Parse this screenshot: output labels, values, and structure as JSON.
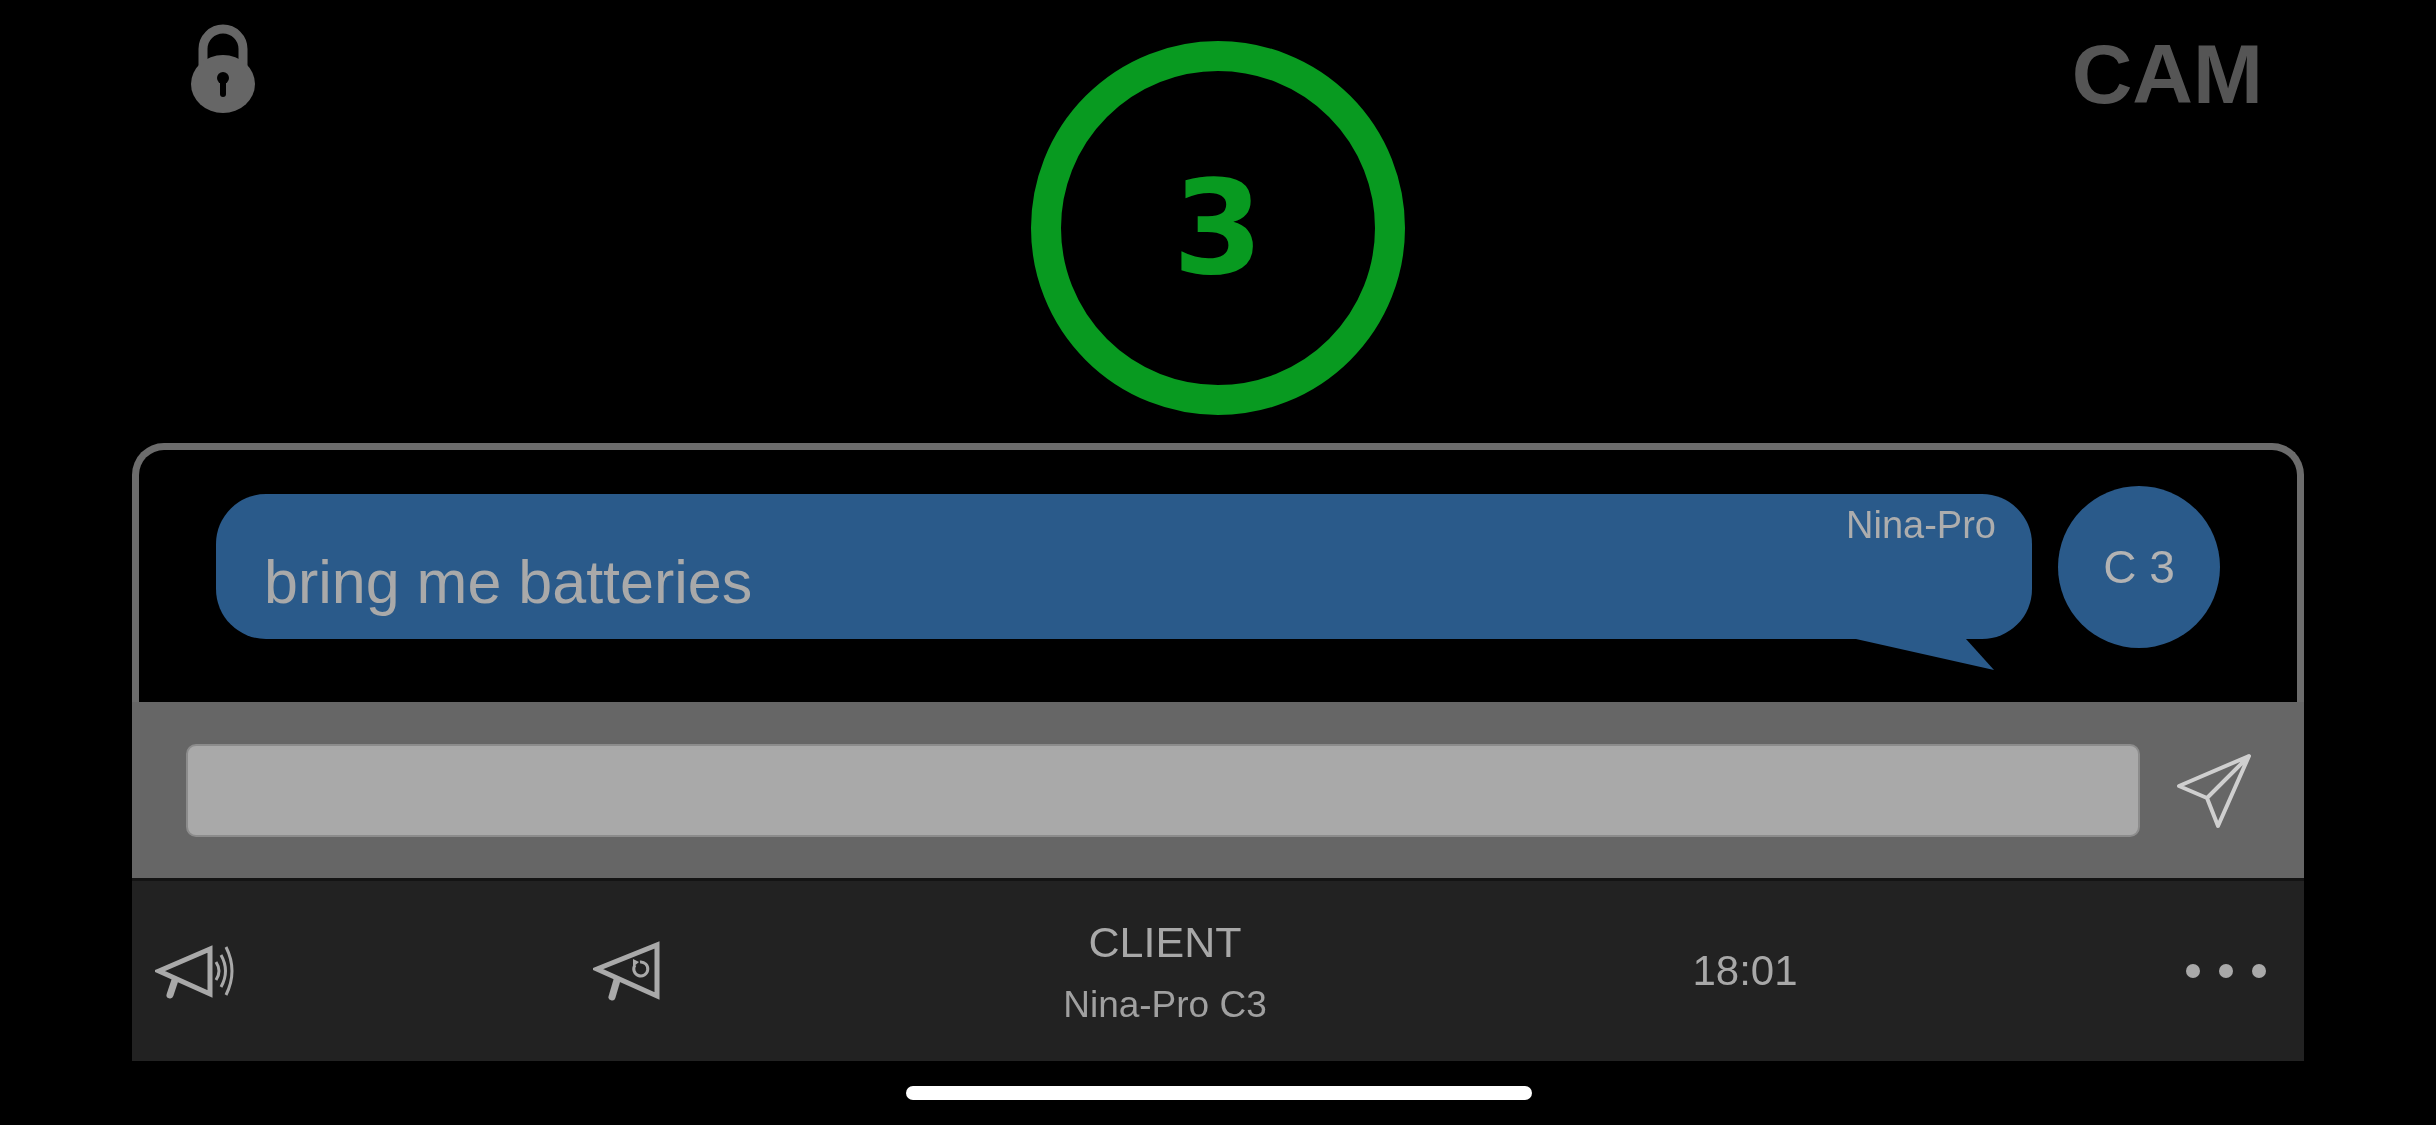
{
  "header": {
    "camera_label": "CAM"
  },
  "countdown": {
    "value": "3"
  },
  "messages": [
    {
      "sender": "Nina-Pro",
      "text": "bring me batteries",
      "avatar_label": "C 3"
    }
  ],
  "bottom_bar": {
    "title": "CLIENT",
    "subtitle": "Nina-Pro C3",
    "time": "18:01"
  }
}
